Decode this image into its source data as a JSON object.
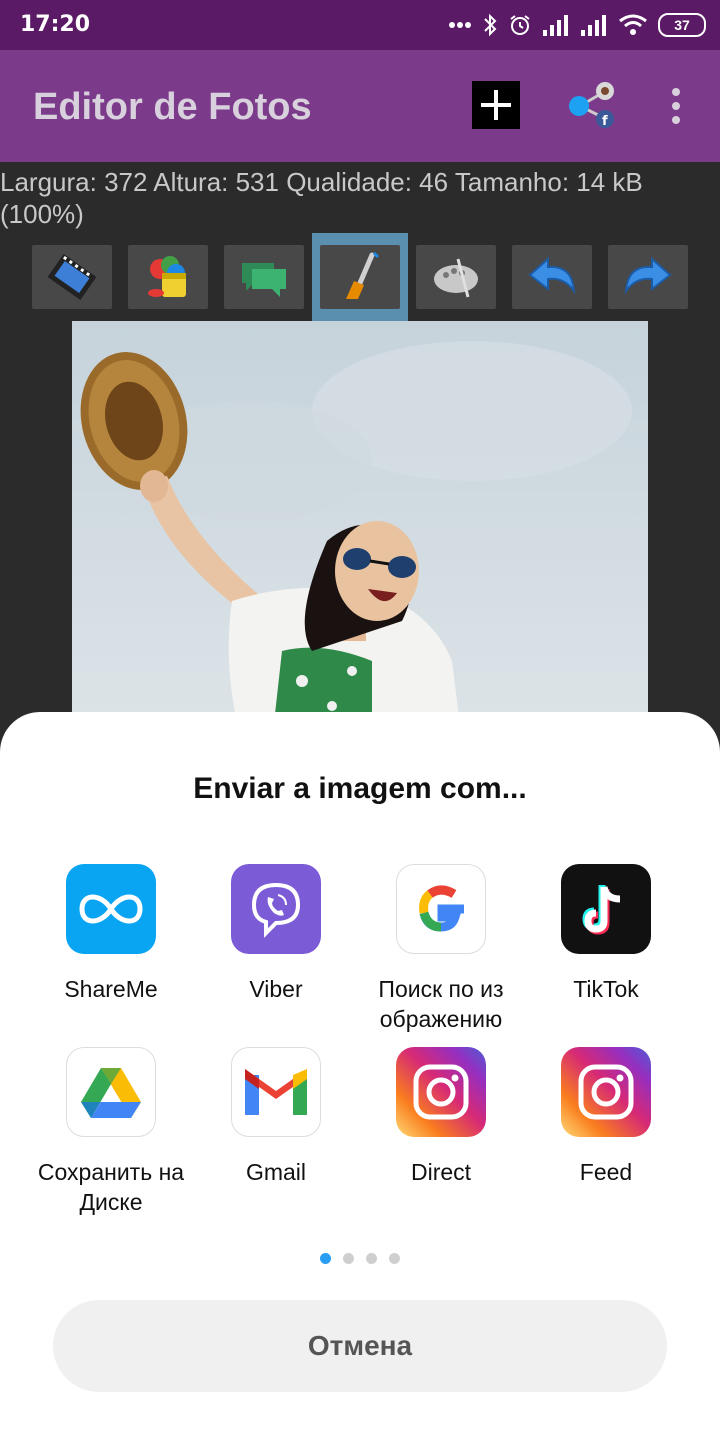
{
  "status": {
    "time": "17:20",
    "battery": "37"
  },
  "appbar": {
    "title": "Editor de Fotos"
  },
  "info": {
    "line1": "Largura: 372 Altura: 531 Qualidade: 46 Tamanho: 14 kB",
    "line2": "(100%)"
  },
  "toolbar": {
    "selected_index": 3
  },
  "sheet": {
    "title": "Enviar a imagem com...",
    "apps": [
      {
        "label": "ShareMe",
        "icon": "shareme-icon"
      },
      {
        "label": "Viber",
        "icon": "viber-icon"
      },
      {
        "label": "Поиск по из ображению",
        "icon": "google-icon"
      },
      {
        "label": "TikTok",
        "icon": "tiktok-icon"
      },
      {
        "label": "Сохранить на Диске",
        "icon": "google-drive-icon"
      },
      {
        "label": "Gmail",
        "icon": "gmail-icon"
      },
      {
        "label": "Direct",
        "icon": "instagram-icon"
      },
      {
        "label": "Feed",
        "icon": "instagram-icon"
      }
    ],
    "page_count": 4,
    "current_page": 1,
    "cancel_label": "Отмена"
  },
  "colors": {
    "statusbar": "#5b1a66",
    "appbar": "#7b3a8a",
    "accent": "#2a9df4"
  }
}
